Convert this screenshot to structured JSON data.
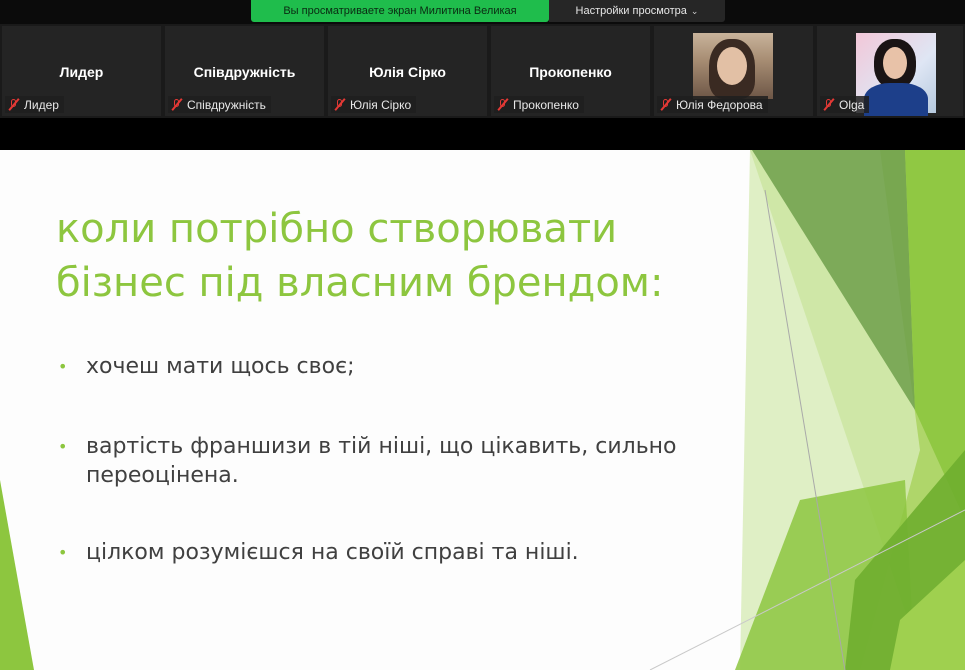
{
  "top_bar": {
    "sharing_banner": "Вы просматриваете экран Милитина Великая",
    "view_options_label": "Настройки просмотра",
    "view_options_icon": "chevron-down-icon"
  },
  "participants": [
    {
      "display_name": "Лидер",
      "tag": "Лидер",
      "video": false
    },
    {
      "display_name": "Співдружність",
      "tag": "Співдружність",
      "video": false
    },
    {
      "display_name": "Юлія Сірко",
      "tag": "Юлія Сірко",
      "video": false
    },
    {
      "display_name": "Прокопенко",
      "tag": "Прокопенко",
      "video": false
    },
    {
      "display_name": "",
      "tag": "Юлія Федорова",
      "video": true
    },
    {
      "display_name": "",
      "tag": "Olga",
      "video": true
    }
  ],
  "slide": {
    "title_line1": "коли потрібно створювати",
    "title_line2": "бізнес під власним брендом:",
    "bullets": [
      {
        "line1": "хочеш мати щось своє;",
        "line2": ""
      },
      {
        "line1": "вартість франшизи в тій ніші, що цікавить, сильно",
        "line2": "переоцінена."
      },
      {
        "line1": "цілком розумієшся на своїй справі та ніші.",
        "line2": ""
      }
    ],
    "bullet_glyph": "•",
    "accent_color": "#8dc63f"
  },
  "colors": {
    "share_banner_bg": "#1fbd4c",
    "muted_icon": "#e53935",
    "slide_text": "#404040"
  }
}
